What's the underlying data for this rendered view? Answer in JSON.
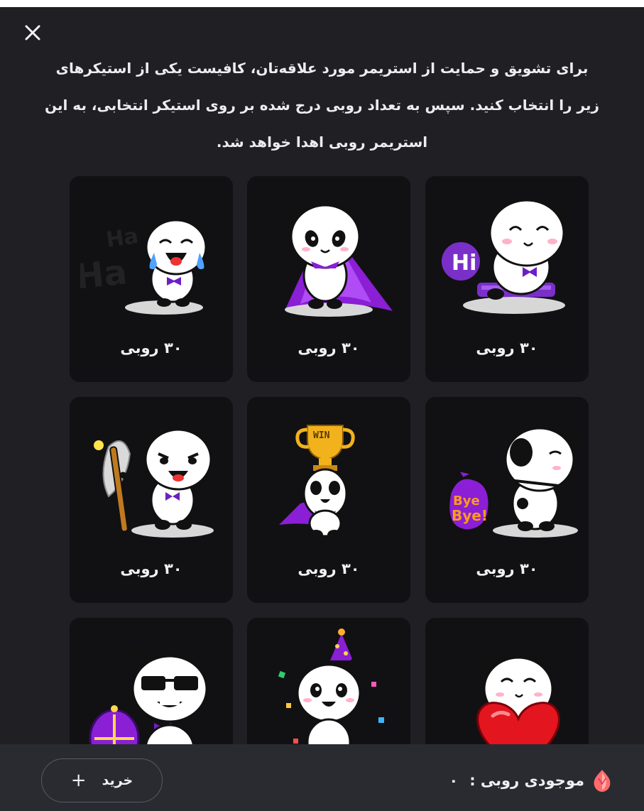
{
  "dialog": {
    "close_icon": "close-icon",
    "intro_text": "برای تشویق و حمایت از استریمر مورد علاقه‌تان، کافیست یکی از استیکرهای زیر را انتخاب کنید. سپس به تعداد روبی درج شده بر روی استیکر انتخابی، به این استریمر روبی اهدا خواهد شد."
  },
  "stickers": [
    {
      "name": "panda-hi-keyboard",
      "price": "۳۰ روبی"
    },
    {
      "name": "panda-purple-cape",
      "price": "۳۰ روبی"
    },
    {
      "name": "panda-haha-laughing",
      "price": "۳۰ روبی"
    },
    {
      "name": "panda-bye-bye-bag",
      "price": "۳۰ روبی"
    },
    {
      "name": "panda-win-trophy",
      "price": "۳۰ روبی"
    },
    {
      "name": "panda-torch-angry",
      "price": "۳۰ روبی"
    },
    {
      "name": "panda-red-heart",
      "price": ""
    },
    {
      "name": "panda-party-hat",
      "price": ""
    },
    {
      "name": "panda-sunglasses-gem",
      "price": ""
    }
  ],
  "footer": {
    "balance_label": "موجودی روبی :",
    "balance_value": "۰",
    "buy_label": "خرید",
    "buy_icon": "plus-icon",
    "ruby_icon": "ruby-gem-icon",
    "accent": "#7b1fd6",
    "ruby_color": "#ff6b8b"
  }
}
